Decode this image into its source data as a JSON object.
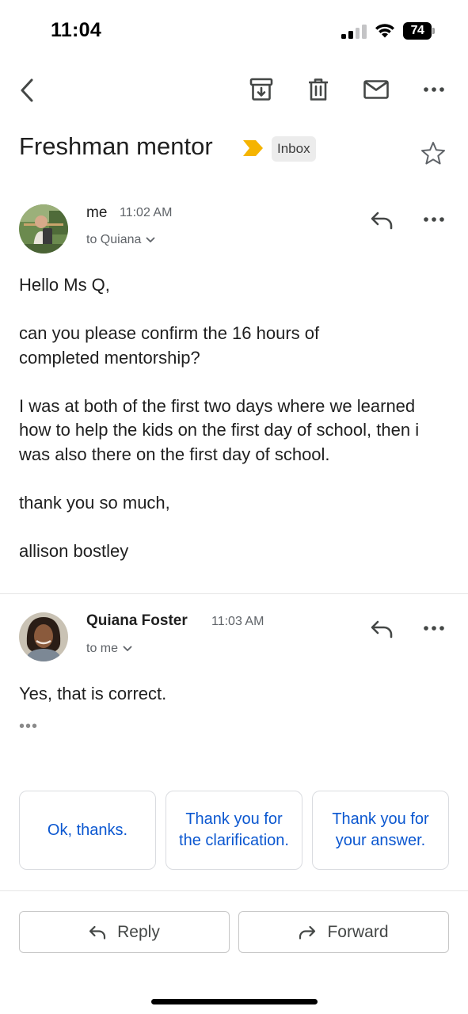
{
  "status_bar": {
    "time": "11:04",
    "battery": "74"
  },
  "toolbar": {
    "back_icon": "chevron-left-icon",
    "archive_icon": "archive-icon",
    "delete_icon": "trash-icon",
    "mark_unread_icon": "mail-icon",
    "more_icon": "more-horizontal-icon"
  },
  "thread": {
    "subject": "Freshman mentor",
    "label": "Inbox",
    "important_color": "#f5b400"
  },
  "messages": [
    {
      "sender": "me",
      "time": "11:02 AM",
      "to": "to Quiana",
      "body": [
        "Hello Ms Q,",
        "can you please confirm the 16 hours of completed mentorship?",
        "I was at both of the first two days where we learned how to help the kids on the first day of school, then i was also there on the first day of school.",
        "thank you so much,",
        "allison bostley"
      ]
    },
    {
      "sender": "Quiana Foster",
      "time": "11:03 AM",
      "to": "to me",
      "body": [
        "Yes, that is correct."
      ],
      "trimmed_indicator": "•••"
    }
  ],
  "smart_replies": [
    "Ok, thanks.",
    "Thank you for the clarification.",
    "Thank you for your answer."
  ],
  "actions": {
    "reply": "Reply",
    "forward": "Forward"
  },
  "colors": {
    "accent": "#0b57d0",
    "text": "#1f1f1f",
    "secondary": "#5f6368"
  }
}
